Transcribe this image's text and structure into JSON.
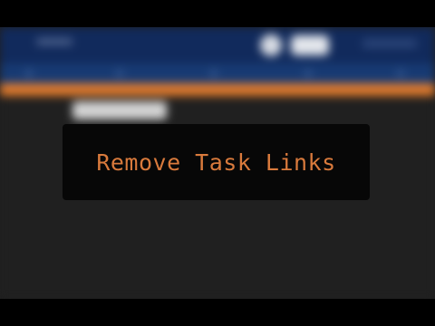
{
  "overlay": {
    "caption": "Remove Task Links"
  },
  "colors": {
    "header_bg": "#112a5c",
    "subbar_bg": "#173a73",
    "accent_orange": "#e07a2c",
    "panel_bg": "#202020",
    "caption_color": "#d97a3c",
    "overlay_bg": "#070707"
  }
}
